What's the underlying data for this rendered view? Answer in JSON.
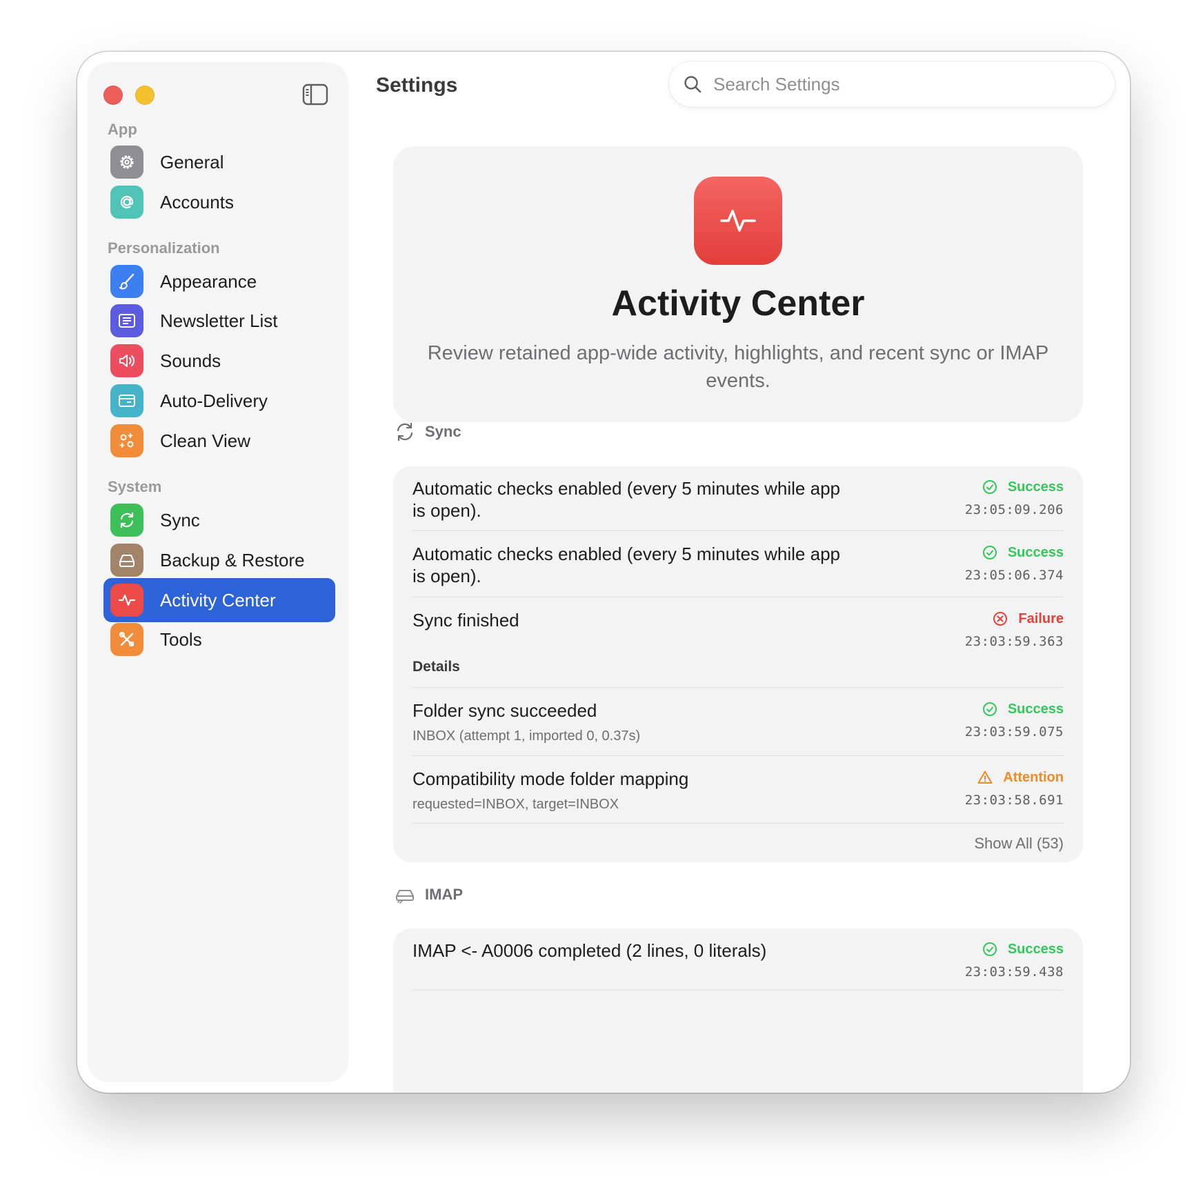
{
  "window": {
    "title": "Settings"
  },
  "search": {
    "placeholder": "Search Settings"
  },
  "sidebar": {
    "sections": [
      {
        "label": "App",
        "items": [
          {
            "label": "General",
            "icon": "gear-icon",
            "color": "#8e8e93"
          },
          {
            "label": "Accounts",
            "icon": "at-icon",
            "color": "#4fc3b5"
          }
        ]
      },
      {
        "label": "Personalization",
        "items": [
          {
            "label": "Appearance",
            "icon": "paintbrush-icon",
            "color": "#3b7ff0"
          },
          {
            "label": "Newsletter List",
            "icon": "newspaper-icon",
            "color": "#5b5ce0"
          },
          {
            "label": "Sounds",
            "icon": "speaker-icon",
            "color": "#ec4d5f"
          },
          {
            "label": "Auto-Delivery",
            "icon": "card-icon",
            "color": "#47b3c9"
          },
          {
            "label": "Clean View",
            "icon": "sparkles-icon",
            "color": "#f08c3a"
          }
        ]
      },
      {
        "label": "System",
        "items": [
          {
            "label": "Sync",
            "icon": "sync-icon",
            "color": "#3dbf5a"
          },
          {
            "label": "Backup & Restore",
            "icon": "drive-icon",
            "color": "#a2846b"
          },
          {
            "label": "Activity Center",
            "icon": "waveform-icon",
            "color": "#ec4a46",
            "active": true
          },
          {
            "label": "Tools",
            "icon": "tools-icon",
            "color": "#f08c3a"
          }
        ]
      }
    ]
  },
  "hero": {
    "title": "Activity Center",
    "description": "Review retained app-wide activity, highlights, and recent sync or IMAP events."
  },
  "sync": {
    "header": "Sync",
    "rows": [
      {
        "title": "Automatic checks enabled (every 5 minutes while app is open).",
        "status": "Success",
        "time": "23:05:09.206"
      },
      {
        "title": "Automatic checks enabled (every 5 minutes while app is open).",
        "status": "Success",
        "time": "23:05:06.374"
      },
      {
        "title": "Sync finished",
        "details": "Details",
        "status": "Failure",
        "time": "23:03:59.363"
      },
      {
        "title": "Folder sync succeeded",
        "subtitle": "INBOX (attempt 1, imported 0, 0.37s)",
        "status": "Success",
        "time": "23:03:59.075"
      },
      {
        "title": "Compatibility mode folder mapping",
        "subtitle": "requested=INBOX, target=INBOX",
        "status": "Attention",
        "time": "23:03:58.691"
      }
    ],
    "show_all": "Show All (53)"
  },
  "imap": {
    "header": "IMAP",
    "rows": [
      {
        "title": "IMAP <- A0006 completed (2 lines, 0 literals)",
        "status": "Success",
        "time": "23:03:59.438"
      }
    ]
  },
  "colors": {
    "success": "#34c759",
    "failure": "#e5403a",
    "attention": "#f08a24",
    "accent": "#2d62d8"
  }
}
